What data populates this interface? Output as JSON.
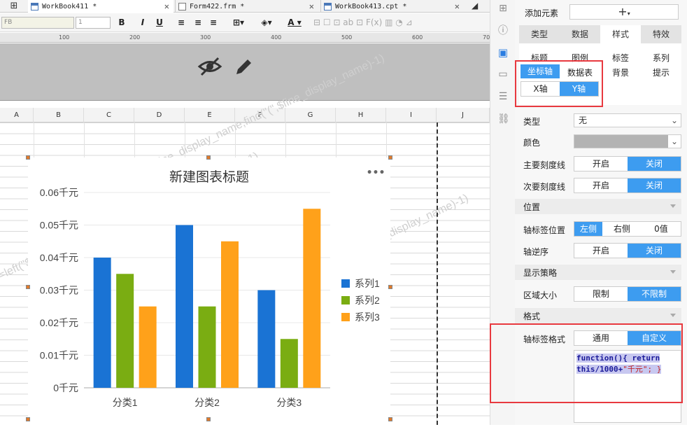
{
  "tabs": [
    {
      "label": "WorkBook411 *",
      "active": true
    },
    {
      "label": "Form422.frm *",
      "active": false
    },
    {
      "label": "WorkBook413.cpt *",
      "active": false
    }
  ],
  "toolbar": {
    "font_name": "FB",
    "font_size": "1",
    "bold": "B",
    "italic": "I",
    "underline": "U"
  },
  "ruler": [
    "100",
    "200",
    "300",
    "400",
    "500",
    "600",
    "700"
  ],
  "columns": [
    "A",
    "B",
    "C",
    "D",
    "E",
    "F",
    "G",
    "H",
    "I",
    "J"
  ],
  "watermark": "=left(\"$fine_display_name,find(\"(\",$fine_display_name)-1)",
  "chart_data": {
    "type": "bar",
    "title": "新建图表标题",
    "categories": [
      "分类1",
      "分类2",
      "分类3"
    ],
    "series": [
      {
        "name": "系列1",
        "color": "#1a73d4",
        "values": [
          0.04,
          0.05,
          0.03
        ]
      },
      {
        "name": "系列2",
        "color": "#7aad12",
        "values": [
          0.035,
          0.025,
          0.015
        ]
      },
      {
        "name": "系列3",
        "color": "#ffa11a",
        "values": [
          0.025,
          0.045,
          0.055
        ]
      }
    ],
    "yticks": [
      "0千元",
      "0.01千元",
      "0.02千元",
      "0.03千元",
      "0.04千元",
      "0.05千元",
      "0.06千元"
    ],
    "ylim": [
      0,
      0.06
    ],
    "legend": "right",
    "menu": "•••"
  },
  "panel": {
    "add_element": "添加元素",
    "add_symbol": "+",
    "main_tabs": [
      "类型",
      "数据",
      "样式",
      "特效"
    ],
    "sub_tabs_row1": [
      "标题",
      "图例",
      "标签",
      "系列"
    ],
    "sub_tabs_row2": [
      "坐标轴",
      "数据表",
      "背景",
      "提示"
    ],
    "axis_tabs": [
      "X轴",
      "Y轴"
    ],
    "type_label": "类型",
    "type_value": "无",
    "color_label": "颜色",
    "major_tick_label": "主要刻度线",
    "minor_tick_label": "次要刻度线",
    "on": "开启",
    "off": "关闭",
    "position_section": "位置",
    "axis_label_pos_label": "轴标签位置",
    "pos_options": [
      "左侧",
      "右侧",
      "0值"
    ],
    "reverse_label": "轴逆序",
    "display_section": "显示策略",
    "area_size_label": "区域大小",
    "area_options": [
      "限制",
      "不限制"
    ],
    "format_section": "格式",
    "axis_format_label": "轴标签格式",
    "format_options": [
      "通用",
      "自定义"
    ],
    "code_line1": "function(){ return",
    "code_line2a": "this/1000+",
    "code_line2b": "\"千元\"",
    "code_line2c": "; }"
  }
}
